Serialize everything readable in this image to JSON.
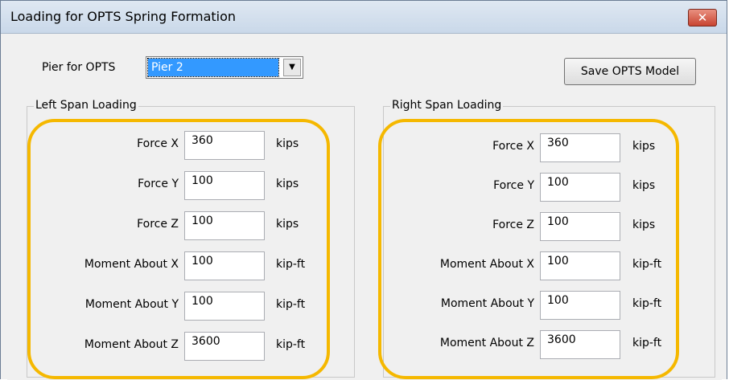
{
  "window": {
    "title": "Loading for OPTS Spring Formation",
    "close_glyph": "✕"
  },
  "pier": {
    "label": "Pier for OPTS",
    "selected": "Pier 2",
    "arrow": "▼"
  },
  "save_label": "Save OPTS Model",
  "left": {
    "title": "Left Span Loading",
    "rows": [
      {
        "name": "Force X",
        "value": "360",
        "unit": "kips"
      },
      {
        "name": "Force Y",
        "value": "100",
        "unit": "kips"
      },
      {
        "name": "Force Z",
        "value": "100",
        "unit": "kips"
      },
      {
        "name": "Moment About X",
        "value": "100",
        "unit": "kip-ft"
      },
      {
        "name": "Moment About Y",
        "value": "100",
        "unit": "kip-ft"
      },
      {
        "name": "Moment About Z",
        "value": "3600",
        "unit": "kip-ft"
      }
    ]
  },
  "right": {
    "title": "Right Span Loading",
    "rows": [
      {
        "name": "Force X",
        "value": "360",
        "unit": "kips"
      },
      {
        "name": "Force Y",
        "value": "100",
        "unit": "kips"
      },
      {
        "name": "Force Z",
        "value": "100",
        "unit": "kips"
      },
      {
        "name": "Moment About X",
        "value": "100",
        "unit": "kip-ft"
      },
      {
        "name": "Moment About Y",
        "value": "100",
        "unit": "kip-ft"
      },
      {
        "name": "Moment About Z",
        "value": "3600",
        "unit": "kip-ft"
      }
    ]
  },
  "colors": {
    "highlight": "#f5b800",
    "selection": "#3399ff"
  }
}
